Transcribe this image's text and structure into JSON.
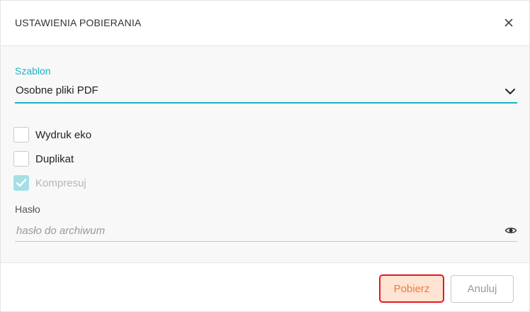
{
  "dialog": {
    "title": "USTAWIENIA POBIERANIA",
    "close_icon": "close-icon"
  },
  "template": {
    "label": "Szablon",
    "value": "Osobne pliki PDF",
    "icon": "chevron-down-icon"
  },
  "options": [
    {
      "label": "Wydruk eko",
      "checked": false,
      "disabled": false
    },
    {
      "label": "Duplikat",
      "checked": false,
      "disabled": false
    },
    {
      "label": "Kompresuj",
      "checked": true,
      "disabled": true
    }
  ],
  "password": {
    "label": "Hasło",
    "placeholder": "hasło do archiwum",
    "value": "",
    "icon": "eye-icon"
  },
  "buttons": {
    "download": "Pobierz",
    "cancel": "Anuluj"
  },
  "colors": {
    "accent": "#1bb3c4",
    "primary_text": "#f07a3c",
    "primary_bg": "#ffe3d3",
    "focus_outline": "#e11b22",
    "checkbox_checked": "#a5dfe6"
  }
}
